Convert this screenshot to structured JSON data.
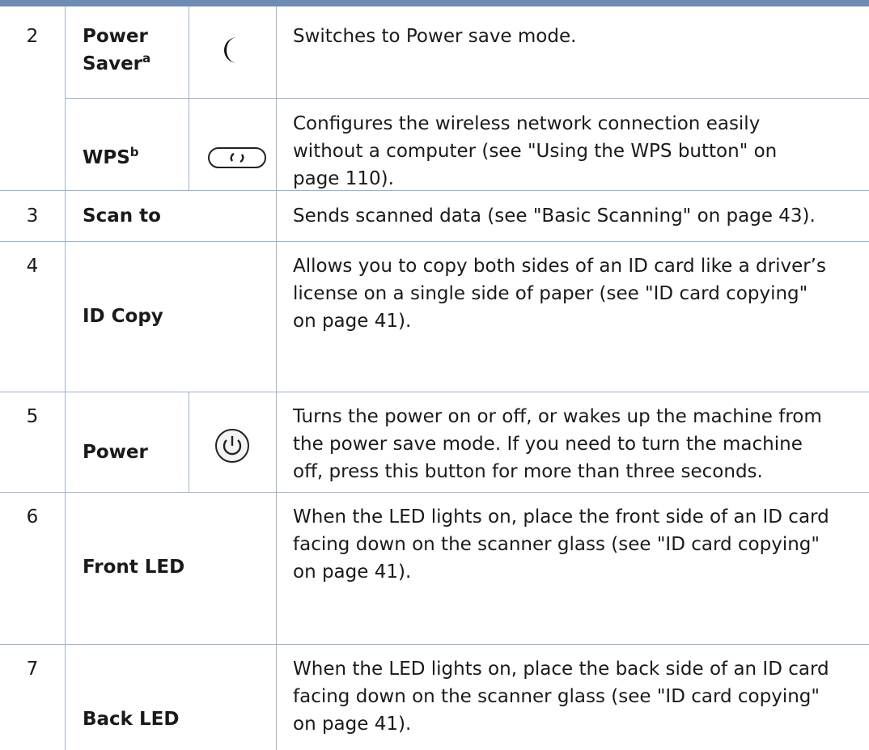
{
  "rows": [
    {
      "num": "2",
      "name": "Power",
      "name2": "Saver",
      "sup": "a",
      "icon": "moon-icon",
      "desc": "Switches to Power save mode."
    },
    {
      "name": "WPS",
      "sup": "b",
      "icon": "wps-button-icon",
      "desc": [
        "Configures the wireless network connection easily",
        "without a computer (see \"Using the WPS button\" on",
        "page 110)."
      ]
    },
    {
      "num": "3",
      "name": "Scan to",
      "desc": "Sends scanned data (see \"Basic Scanning\" on page 43)."
    },
    {
      "num": "4",
      "name": "ID Copy",
      "desc": [
        "Allows you to copy both sides of an ID card like a driver’s",
        "license on a single side of paper (see \"ID card copying\"",
        "on page 41)."
      ]
    },
    {
      "num": "5",
      "name": "Power",
      "icon": "power-icon",
      "desc": [
        "Turns the power on or off, or wakes up the machine from",
        "the power save mode. If you need to turn the machine",
        "off, press this button for more than three seconds."
      ]
    },
    {
      "num": "6",
      "name": "Front LED",
      "desc": [
        "When the LED lights on, place the front side of an ID card",
        "facing down on the scanner glass (see \"ID card copying\"",
        "on page 41)."
      ]
    },
    {
      "num": "7",
      "name": "Back LED",
      "desc": [
        "When the LED lights on, place the back side of an ID card",
        "facing down on the scanner glass (see \"ID card copying\"",
        "on page 41)."
      ]
    }
  ]
}
